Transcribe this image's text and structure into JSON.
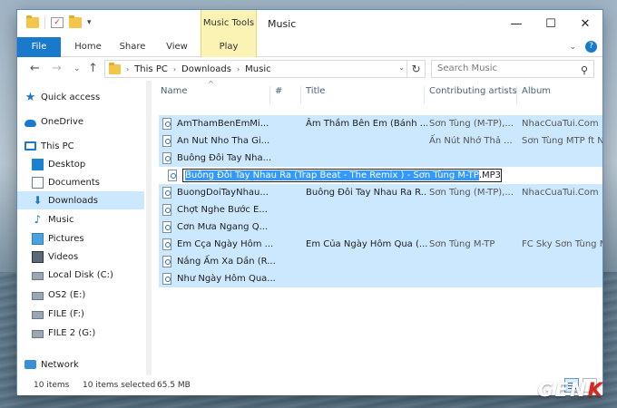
{
  "window": {
    "title": "Music",
    "context_tab_group": "Music Tools",
    "controls": {
      "minimize": "—",
      "maximize": "☐",
      "close": "✕"
    }
  },
  "ribbon": {
    "tabs": [
      {
        "label": "File",
        "active": true
      },
      {
        "label": "Home"
      },
      {
        "label": "Share"
      },
      {
        "label": "View"
      },
      {
        "label": "Play",
        "contextual": true
      }
    ],
    "help_icon": "?",
    "expand_icon": "⌄"
  },
  "address": {
    "breadcrumb": [
      "This PC",
      "Downloads",
      "Music"
    ],
    "search_placeholder": "Search Music"
  },
  "nav": {
    "items": [
      {
        "label": "Quick access",
        "icon": "star-icon"
      },
      {
        "label": "OneDrive",
        "icon": "cloud-icon"
      },
      {
        "label": "This PC",
        "icon": "computer-icon"
      },
      {
        "label": "Desktop",
        "icon": "desktop-icon"
      },
      {
        "label": "Documents",
        "icon": "documents-icon"
      },
      {
        "label": "Downloads",
        "icon": "download-icon",
        "selected": true
      },
      {
        "label": "Music",
        "icon": "music-icon"
      },
      {
        "label": "Pictures",
        "icon": "pictures-icon"
      },
      {
        "label": "Videos",
        "icon": "videos-icon"
      },
      {
        "label": "Local Disk (C:)",
        "icon": "disk-icon"
      },
      {
        "label": "OS2 (E:)",
        "icon": "disk-icon"
      },
      {
        "label": "FILE (F:)",
        "icon": "disk-icon"
      },
      {
        "label": "FILE 2 (G:)",
        "icon": "disk-icon"
      },
      {
        "label": "Network",
        "icon": "network-icon"
      }
    ]
  },
  "columns": [
    "Name",
    "#",
    "Title",
    "Contributing artists",
    "Album"
  ],
  "files": [
    {
      "name": "AmThamBenEmMi...",
      "title": "Âm Thầm Bên Em (Bánh ...",
      "artists": "Sơn Tùng (M-TP),...",
      "album": "NhacCuaTui.Com"
    },
    {
      "name": "An Nut Nho Tha Gi...",
      "title": "",
      "artists": "Ấn Nút Nhớ Thả ...",
      "album": "Sơn Tùng MTP ft N"
    },
    {
      "name": "Buông Đôi Tay Nha...",
      "title": "",
      "artists": "",
      "album": ""
    },
    {
      "name": "Buông Đôi Tay Nhau Ra (Trap Beat - The Remix ) - Sơn Tùng M-TP.MP3",
      "rename_selected": "Buông Đôi Tay Nhau Ra (Trap Beat - The Remix ) - Sơn Tùng M-TP",
      "rename_ext": ".MP3",
      "renaming": true
    },
    {
      "name": "BuongDoiTayNhau...",
      "title": "Buông Đôi Tay Nhau Ra R...",
      "artists": "Sơn Tùng (M-TP),...",
      "album": "NhacCuaTui.Com"
    },
    {
      "name": "Chợt Nghe Bước E...",
      "title": "",
      "artists": "",
      "album": ""
    },
    {
      "name": "Cơn Mưa Ngang Q...",
      "title": "",
      "artists": "",
      "album": ""
    },
    {
      "name": "Em Cça Ngày Hôm ...",
      "title": "Em Của Ngày Hôm Qua (...",
      "artists": "Sơn Tùng M-TP",
      "album": "FC Sky Sơn Tùng M"
    },
    {
      "name": "Nắng Ấm Xa Dần (R...",
      "title": "",
      "artists": "",
      "album": ""
    },
    {
      "name": "Như Ngày Hôm Qua...",
      "title": "",
      "artists": "",
      "album": ""
    }
  ],
  "status": {
    "items": "10 items",
    "selected": "10 items selected",
    "size": "65.5 MB"
  },
  "logo": {
    "text": "GEN",
    "accent": "K"
  },
  "colors": {
    "accent": "#1979ca",
    "selection": "#cce8ff",
    "contextual_tab": "#fbf3b4"
  }
}
